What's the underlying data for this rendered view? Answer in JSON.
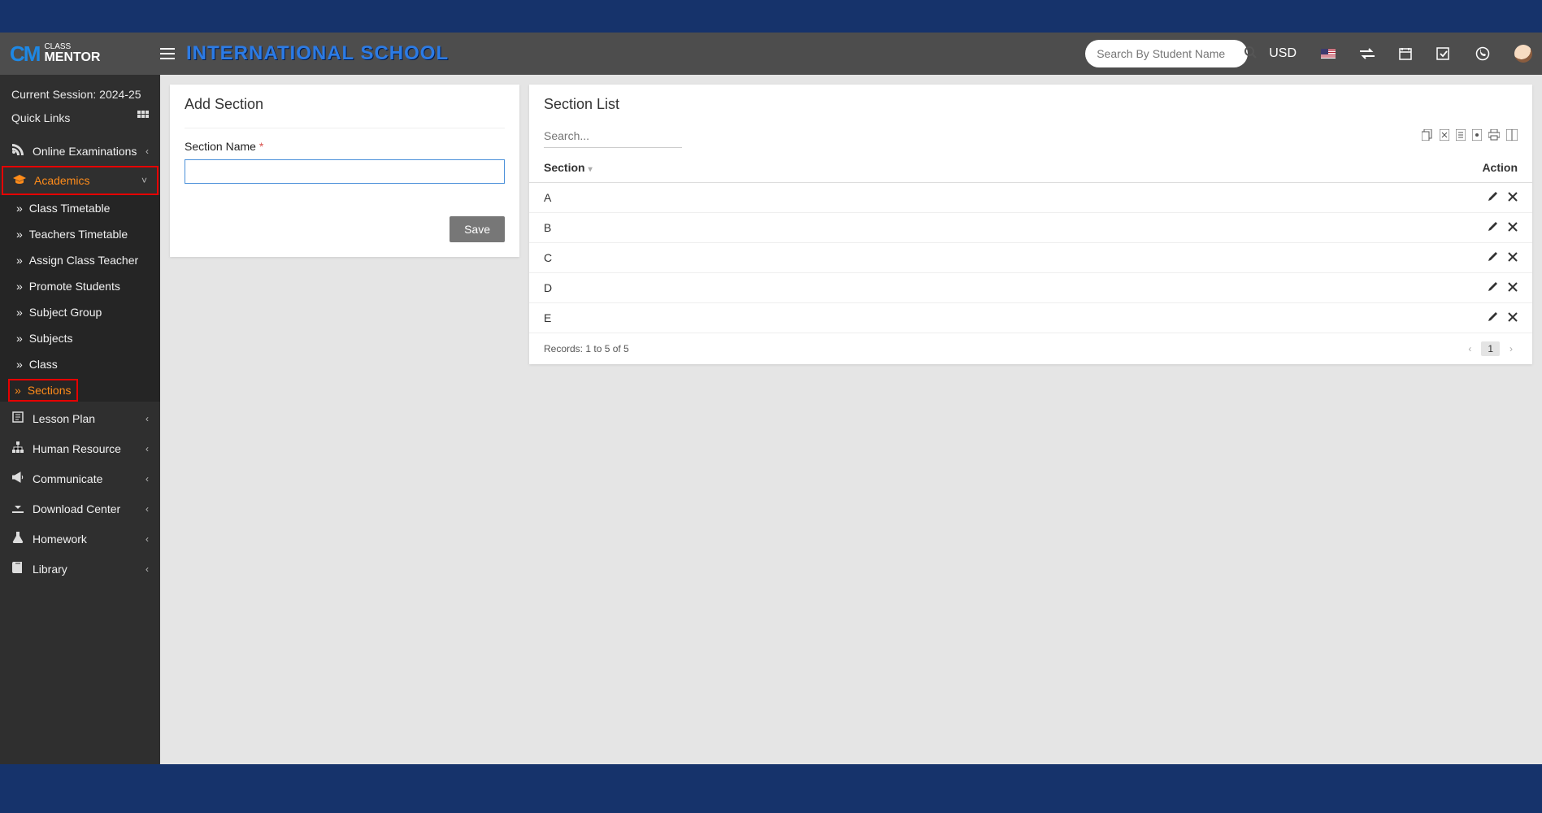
{
  "header": {
    "school_name": "INTERNATIONAL SCHOOL",
    "search_placeholder": "Search By Student Name",
    "currency": "USD"
  },
  "logo": {
    "brand_top": "CLASS",
    "brand_bottom": "MENTOR"
  },
  "sidebar": {
    "session_label": "Current Session: 2024-25",
    "quick_links": "Quick Links",
    "items": [
      {
        "label": "Online Examinations"
      },
      {
        "label": "Academics"
      },
      {
        "label": "Lesson Plan"
      },
      {
        "label": "Human Resource"
      },
      {
        "label": "Communicate"
      },
      {
        "label": "Download Center"
      },
      {
        "label": "Homework"
      },
      {
        "label": "Library"
      }
    ],
    "academics_sub": [
      {
        "label": "Class Timetable"
      },
      {
        "label": "Teachers Timetable"
      },
      {
        "label": "Assign Class Teacher"
      },
      {
        "label": "Promote Students"
      },
      {
        "label": "Subject Group"
      },
      {
        "label": "Subjects"
      },
      {
        "label": "Class"
      },
      {
        "label": "Sections"
      }
    ]
  },
  "add_section": {
    "title": "Add Section",
    "field_label": "Section Name",
    "save_button": "Save"
  },
  "section_list": {
    "title": "Section List",
    "search_placeholder": "Search...",
    "columns": {
      "section": "Section",
      "action": "Action"
    },
    "rows": [
      {
        "name": "A"
      },
      {
        "name": "B"
      },
      {
        "name": "C"
      },
      {
        "name": "D"
      },
      {
        "name": "E"
      }
    ],
    "records_text": "Records: 1 to 5 of 5",
    "page_current": "1"
  },
  "colors": {
    "accent_orange": "#ff8c1a",
    "brand_blue": "#16336b",
    "topbar_gray": "#4d4d4d"
  }
}
